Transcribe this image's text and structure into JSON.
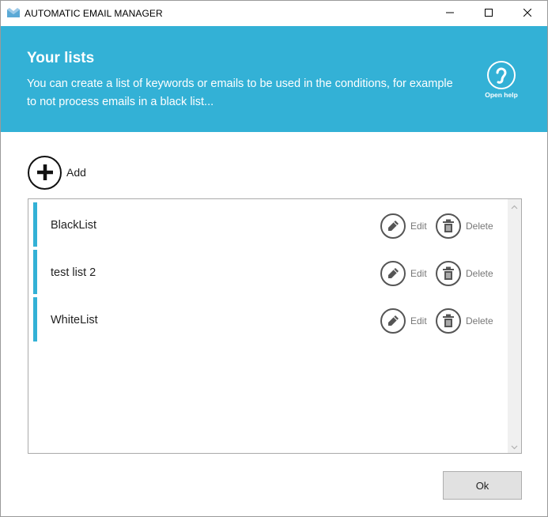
{
  "window": {
    "title": "AUTOMATIC EMAIL MANAGER",
    "app_icon": "envelope-icon",
    "controls": [
      "minimize-icon",
      "maximize-icon",
      "close-icon"
    ]
  },
  "banner": {
    "title": "Your lists",
    "description": "You can create a list of keywords or emails to be used in the conditions, for example to not process emails in a black list...",
    "help_label": "Open help",
    "help_icon": "help-icon",
    "background_color": "#33b1d6"
  },
  "add": {
    "label": "Add",
    "icon": "plus-circle-icon"
  },
  "lists": {
    "items": [
      {
        "name": "BlackList",
        "edit_label": "Edit",
        "delete_label": "Delete"
      },
      {
        "name": "test list 2",
        "edit_label": "Edit",
        "delete_label": "Delete"
      },
      {
        "name": "WhiteList",
        "edit_label": "Edit",
        "delete_label": "Delete"
      }
    ],
    "edit_icon": "pencil-icon",
    "delete_icon": "trash-icon",
    "accent_color": "#33b1d6"
  },
  "footer": {
    "ok_label": "Ok"
  }
}
